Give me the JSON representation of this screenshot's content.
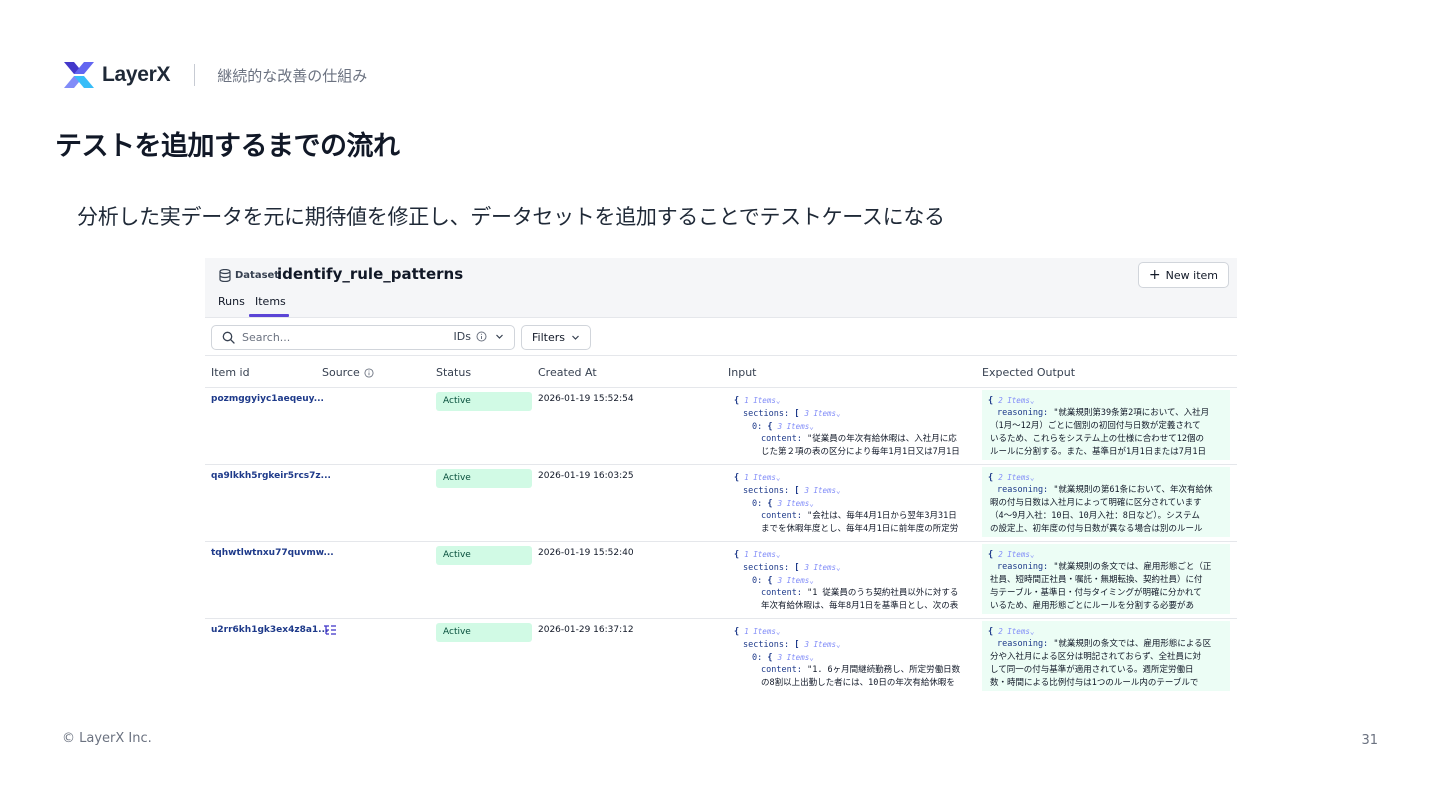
{
  "slide": {
    "brand_name": "LayerX",
    "section": "継続的な改善の仕組み",
    "title": "テストを追加するまでの流れ",
    "lead": "分析した実データを元に期待値を修正し、データセットを追加することでテストケースになる",
    "copyright": "© LayerX Inc.",
    "page_number": "31"
  },
  "app": {
    "dataset_tag": "Dataset",
    "dataset_name": "identify_rule_patterns",
    "new_item_label": "New item",
    "tabs": [
      {
        "label": "Runs"
      },
      {
        "label": "Items"
      }
    ],
    "search": {
      "placeholder": "Search...",
      "ids_label": "IDs"
    },
    "filters_label": "Filters",
    "columns": [
      "Item id",
      "Source",
      "Status",
      "Created At",
      "Input",
      "Expected Output"
    ],
    "rows": [
      {
        "id": "pozmggyiyc1aeqeuy...",
        "status": "Active",
        "created_at": "2026-01-19 15:52:54",
        "input": {
          "meta1": "1 Items",
          "meta2": "3 Items",
          "meta3": "3 Items",
          "line1": "\"従業員の年次有給休暇は、入社月に応",
          "line2": "じた第２項の表の区分により毎年1月1日又は7月1日"
        },
        "output": {
          "meta": "2 Items",
          "line1": "\"就業規則第39条第2項において、入社月",
          "line2": "（1月〜12月）ごとに個別の初回付与日数が定義されて",
          "line3": "いるため、これらをシステム上の仕様に合わせて12個の",
          "line4": "ルールに分割する。また、基準日が1月1日または7月1日"
        }
      },
      {
        "id": "qa9lkkh5rgkeir5rcs7z...",
        "status": "Active",
        "created_at": "2026-01-19 16:03:25",
        "input": {
          "meta1": "1 Items",
          "meta2": "3 Items",
          "meta3": "3 Items",
          "line1": "\"会社は、毎年4月1日から翌年3月31日",
          "line2": "までを休暇年度とし、毎年4月1日に前年度の所定労"
        },
        "output": {
          "meta": "2 Items",
          "line1": "\"就業規則の第61条において、年次有給休",
          "line2": "暇の付与日数は入社月によって明確に区分されています",
          "line3": "（4〜9月入社：10日、10月入社：8日など）。システム",
          "line4": "の設定上、初年度の付与日数が異なる場合は別のルール"
        }
      },
      {
        "id": "tqhwtlwtnxu77quvmw...",
        "status": "Active",
        "created_at": "2026-01-19 15:52:40",
        "input": {
          "meta1": "1 Items",
          "meta2": "3 Items",
          "meta3": "3 Items",
          "line1": "\"1 従業員のうち契約社員以外に対する",
          "line2": "年次有給休暇は、毎年8月1日を基準日とし、次の表"
        },
        "output": {
          "meta": "2 Items",
          "line1": "\"就業規則の条文では、雇用形態ごと（正",
          "line2": "社員、短時間正社員・嘱託・無期転換、契約社員）に付",
          "line3": "与テーブル・基準日・付与タイミングが明確に分かれて",
          "line4": "いるため、雇用形態ごとにルールを分割する必要があ"
        }
      },
      {
        "id": "u2rr6kh1gk3ex4z8a1...",
        "status": "Active",
        "created_at": "2026-01-29 16:37:12",
        "input": {
          "meta1": "1 Items",
          "meta2": "3 Items",
          "meta3": "3 Items",
          "line1": "\"1. 6ヶ月間継続勤務し、所定労働日数",
          "line2": "の8割以上出勤した者には、10日の年次有給休暇を"
        },
        "output": {
          "meta": "2 Items",
          "line1": "\"就業規則の条文では、雇用形態による区",
          "line2": "分や入社月による区分は明記されておらず、全社員に対",
          "line3": "して同一の付与基準が適用されている。週所定労働日",
          "line4": "数・時間による比例付与は1つのルール内のテーブルで"
        }
      }
    ]
  },
  "colors": {
    "accent": "#5b45d6",
    "badge_bg": "#d1fae5",
    "output_bg": "#ecfdf5",
    "json_blue": "#1e3a8a"
  },
  "icons": {
    "logo": "layerx-logo-icon",
    "dataset": "database-icon",
    "search": "search-icon",
    "info": "info-icon",
    "chevron": "chevron-down-icon",
    "source": "trace-icon"
  }
}
